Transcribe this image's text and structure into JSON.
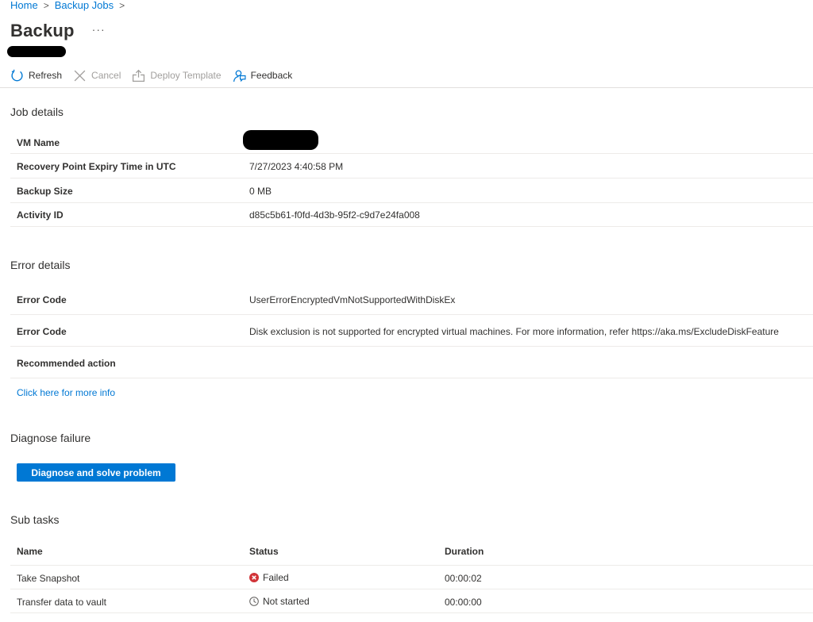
{
  "breadcrumb": {
    "items": [
      "Home",
      "Backup Jobs"
    ],
    "separator": ">"
  },
  "header": {
    "title": "Backup",
    "more": "···"
  },
  "toolbar": {
    "refresh": "Refresh",
    "cancel": "Cancel",
    "deploy_template": "Deploy Template",
    "feedback": "Feedback"
  },
  "job_details": {
    "title": "Job details",
    "rows": [
      {
        "key": "VM Name",
        "value": ""
      },
      {
        "key": "Recovery Point Expiry Time in UTC",
        "value": "7/27/2023 4:40:58 PM"
      },
      {
        "key": "Backup Size",
        "value": "0 MB"
      },
      {
        "key": "Activity ID",
        "value": "d85c5b61-f0fd-4d3b-95f2-c9d7e24fa008"
      }
    ]
  },
  "error_details": {
    "title": "Error details",
    "rows": [
      {
        "key": "Error Code",
        "value": "UserErrorEncryptedVmNotSupportedWithDiskEx"
      },
      {
        "key": "Error Code",
        "value": "Disk exclusion is not supported for encrypted virtual machines. For more information, refer https://aka.ms/ExcludeDiskFeature"
      },
      {
        "key": "Recommended action",
        "value": ""
      }
    ],
    "more_info_link": "Click here for more info"
  },
  "diagnose": {
    "title": "Diagnose failure",
    "button_label": "Diagnose and solve problem"
  },
  "sub_tasks": {
    "title": "Sub tasks",
    "columns": [
      "Name",
      "Status",
      "Duration"
    ],
    "rows": [
      {
        "name": "Take Snapshot",
        "status": "Failed",
        "status_icon": "error-circle-icon",
        "duration": "00:00:02"
      },
      {
        "name": "Transfer data to vault",
        "status": "Not started",
        "status_icon": "clock-icon",
        "duration": "00:00:00"
      }
    ]
  },
  "colors": {
    "accent": "#0078d4",
    "error": "#d13438",
    "text": "#323130",
    "disabled": "#a19f9d"
  }
}
